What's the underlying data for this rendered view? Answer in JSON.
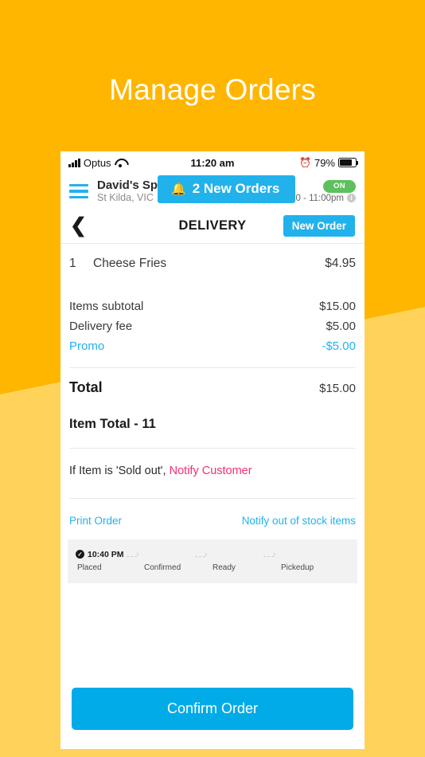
{
  "page": {
    "title": "Manage Orders",
    "background_color": "#FFB600",
    "wedge_color": "#FFD25A"
  },
  "status_bar": {
    "carrier": "Optus",
    "time": "11:20 am",
    "battery_percent": "79%",
    "signal_icon": "signal-bars-icon",
    "wifi_icon": "wifi-icon",
    "alarm_icon": "alarm-clock-icon",
    "battery_icon": "battery-icon"
  },
  "app_header": {
    "menu_icon": "hamburger-menu-icon",
    "store_name": "David's Spi",
    "store_location": "St Kilda, VIC",
    "status_toggle": "ON",
    "hours": "Fri 10:00 - 11:00pm",
    "info_icon": "info-icon",
    "banner": {
      "bell_icon": "bell-icon",
      "label": "2 New Orders",
      "color": "#21B2EC"
    }
  },
  "nav_bar": {
    "back_icon": "back-chevron-icon",
    "title": "DELIVERY",
    "new_order_label": "New Order"
  },
  "order_items": [
    {
      "qty": "1",
      "name": "Cheese Fries",
      "price": "$4.95"
    }
  ],
  "totals": [
    {
      "label": "Items subtotal",
      "value": "$15.00",
      "accent": false
    },
    {
      "label": "Delivery fee",
      "value": "$5.00",
      "accent": false
    },
    {
      "label": "Promo",
      "value": "-$5.00",
      "accent": true
    }
  ],
  "grand_total": {
    "label": "Total",
    "value": "$15.00"
  },
  "item_total": "Item Total - 11",
  "sold_out": {
    "prefix": "If Item is 'Sold out', ",
    "link": "Notify Customer",
    "link_color": "#F4306D"
  },
  "actions": {
    "print": "Print Order",
    "notify_stock": "Notify out of stock items"
  },
  "tracker": {
    "time": "10:40 PM",
    "check_icon": "check-circle-icon",
    "steps": [
      "Placed",
      "Confirmed",
      "Ready",
      "Pickedup"
    ]
  },
  "confirm": {
    "label": "Confirm Order",
    "color": "#00ABE8"
  }
}
